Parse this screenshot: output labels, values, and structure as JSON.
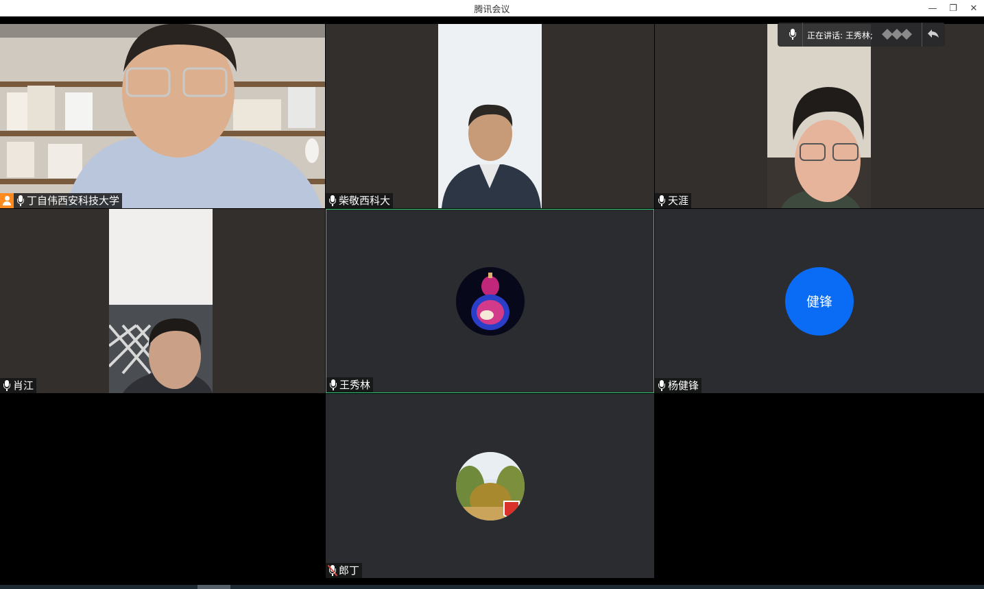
{
  "window": {
    "title": "腾讯会议",
    "minimize_label": "—",
    "restore_label": "❐",
    "close_label": "✕"
  },
  "speaking_indicator": {
    "text": "正在讲话: 王秀林;"
  },
  "participants": [
    {
      "name": "丁自伟西安科技大学",
      "host": true,
      "muted": false
    },
    {
      "name": "柴敬西科大",
      "muted": false
    },
    {
      "name": "天涯",
      "muted": false
    },
    {
      "name": "肖江",
      "muted": false
    },
    {
      "name": "王秀林",
      "muted": false,
      "speaking": true
    },
    {
      "name": "杨健锋",
      "muted": false,
      "avatar_text": "健锋"
    },
    {
      "name": "郎丁",
      "muted": true
    }
  ],
  "colors": {
    "avatar_blue": "#0a6cf5",
    "active_border": "#2ecc71",
    "host_orange": "#ff8a1f"
  }
}
